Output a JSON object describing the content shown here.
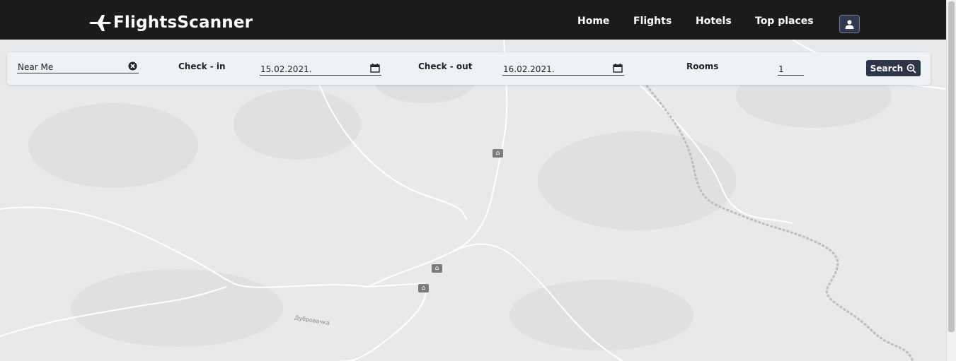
{
  "app": {
    "brand": "FlightsScanner"
  },
  "nav": {
    "home": "Home",
    "flights": "Flights",
    "hotels": "Hotels",
    "top_places": "Top places"
  },
  "icons": {
    "logo": "airplane-icon",
    "user": "user-icon",
    "clear": "clear-circle-icon",
    "calendar": "calendar-icon",
    "search": "magnifier-icon",
    "poi": "hotel-pin-icon"
  },
  "search_form": {
    "location_value": "Near Me",
    "checkin_label": "Check - in",
    "checkin_value": "15.02.2021.",
    "checkout_label": "Check - out",
    "checkout_value": "16.02.2021.",
    "rooms_label": "Rooms",
    "rooms_value": "1",
    "search_label": "Search"
  },
  "map": {
    "place_label": "Дубровачка"
  },
  "colors": {
    "navbar": "#1b1b1b",
    "search_button": "#2c3648",
    "map_background": "#e9e9e9"
  }
}
